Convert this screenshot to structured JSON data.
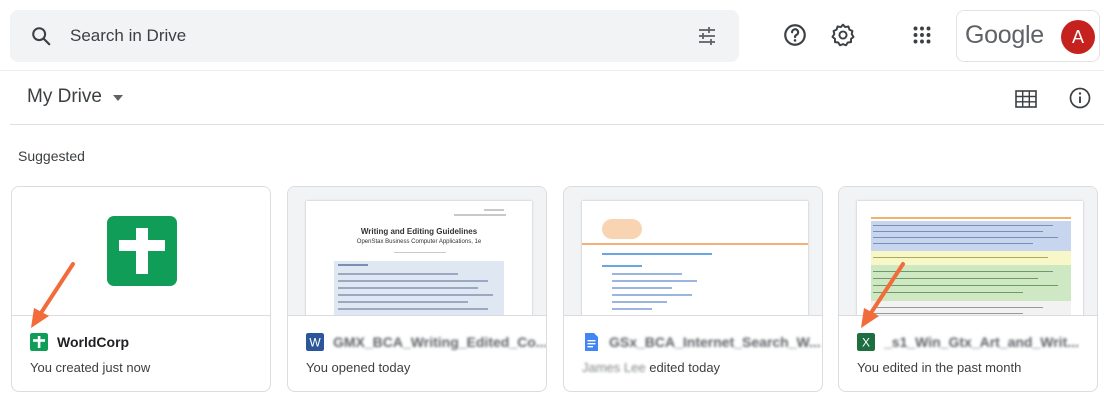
{
  "search": {
    "placeholder": "Search in Drive"
  },
  "header": {
    "brand": "Google",
    "avatar_letter": "A",
    "avatar_color": "#c5221f"
  },
  "drive": {
    "title": "My Drive",
    "section_label": "Suggested"
  },
  "icons": {
    "search": "search-icon",
    "tune": "tune-icon",
    "help": "help-icon",
    "settings": "gear-icon",
    "apps": "apps-grid-icon",
    "view": "grid-view-icon",
    "info": "info-icon"
  },
  "files": [
    {
      "name": "WorldCorp",
      "activity": "You created just now",
      "type": "sheets"
    },
    {
      "name": "GMX_BCA_Writing_Edited_Co...",
      "activity": "You opened today",
      "type": "word"
    },
    {
      "name": "GSx_BCA_Internet_Search_W...",
      "activity_name": "James Lee",
      "activity": "edited today",
      "type": "docs"
    },
    {
      "name": "_s1_Win_Gtx_Art_and_Writ...",
      "activity": "You edited in the past month",
      "type": "excel"
    }
  ],
  "thumb_text": {
    "doc2_title": "Writing and Editing Guidelines",
    "doc2_subtitle": "OpenStax Business Computer Applications, 1e"
  },
  "colors": {
    "sheets_green": "#0f9d58",
    "word_blue": "#2b579a",
    "docs_blue": "#4285f4",
    "excel_green": "#1d6f42",
    "arrow_orange": "#f26b3a"
  }
}
